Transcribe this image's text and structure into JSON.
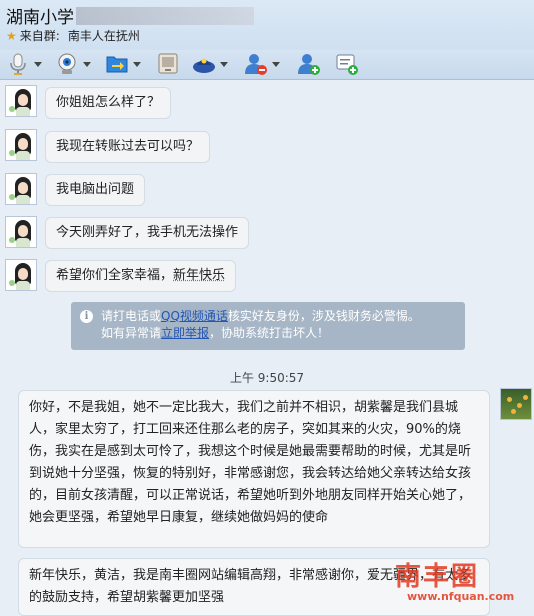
{
  "window": {
    "title": "湖南小学",
    "subtitle_prefix": "来自群:",
    "subtitle_group": "南丰人在抚州"
  },
  "toolbar": {
    "items": [
      {
        "icon": "microphone-icon"
      },
      {
        "icon": "video-camera-icon"
      },
      {
        "icon": "file-transfer-icon"
      },
      {
        "icon": "remote-desktop-icon"
      },
      {
        "icon": "app-icon"
      },
      {
        "icon": "remove-contact-icon"
      },
      {
        "icon": "add-contact-icon"
      },
      {
        "icon": "message-icon"
      }
    ]
  },
  "messages": [
    {
      "text": "你姐姐怎么样了？"
    },
    {
      "text": "我现在转账过去可以吗？"
    },
    {
      "text": "我电脑出问题"
    },
    {
      "text": "今天刚弄好了，我手机无法操作"
    },
    {
      "text_pre": "希望你们全家幸福，",
      "text_ul": "新年快乐"
    }
  ],
  "notice": {
    "line1_pre": "请打电话或",
    "line1_link": "QQ视频通话",
    "line1_post": "核实好友身份，涉及钱财务必警惕。",
    "line2_pre": "如有异常请",
    "line2_link": "立即举报",
    "line2_post": "，协助系统打击坏人！"
  },
  "timestamp": "上午 9:50:57",
  "replies": [
    {
      "text": "你好，不是我姐，她不一定比我大，我们之前并不相识，胡紫馨是我们县城人，家里太穷了，打工回来还住那么老的房子，突如其来的火灾，90%的烧伤，我实在是感到太可怜了，我想这个时候是她最需要帮助的时候，尤其是听到说她十分坚强，恢复的特别好，非常感谢您，我会转达给她父亲转达给女孩的，目前女孩清醒，可以正常说话，希望她听到外地朋友同样开始关心她了，她会更坚强，希望她早日康复，继续她做妈妈的使命"
    },
    {
      "text": "新年快乐，黄洁，我是南丰圈网站编辑高翔，非常感谢你，爱无疆界，有太多的鼓励支持，希望胡紫馨更加坚强"
    }
  ],
  "watermark": {
    "text": "南丰圈",
    "sub": "www.nfquan.com"
  }
}
